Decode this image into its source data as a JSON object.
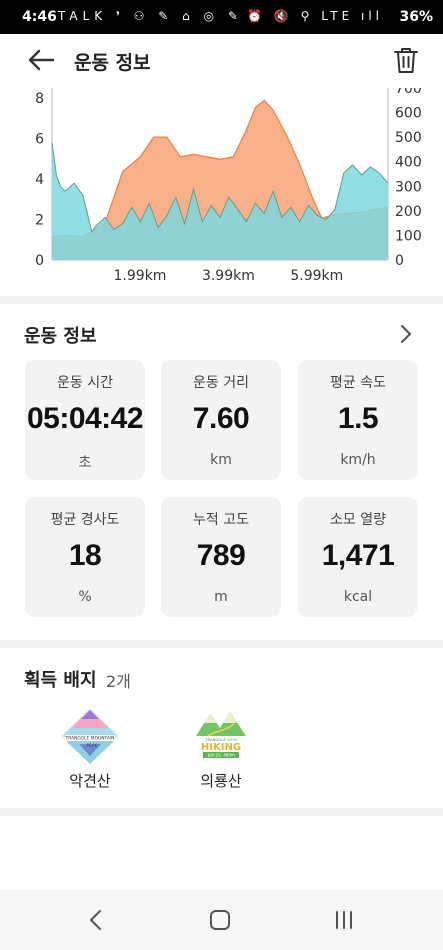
{
  "status_bar": {
    "time": "4:46",
    "left_icons": "TALK ❜ ⚇ ✎ ⌂ ◎ ✎ •",
    "right_icons": "⏰ 🔇 ⚲ LTE ıll",
    "battery": "36%"
  },
  "header": {
    "title": "운동 정보"
  },
  "chart_data": {
    "type": "area",
    "x_tick_labels": [
      "1.99km",
      "3.99km",
      "5.99km"
    ],
    "y_left_ticks": [
      "0",
      "2",
      "4",
      "6",
      "8"
    ],
    "y_right_ticks": [
      "0",
      "100",
      "200",
      "300",
      "400",
      "500",
      "600",
      "700"
    ],
    "ylim_left": [
      0,
      8.5
    ],
    "ylim_right": [
      0,
      700
    ],
    "xlim_km": [
      0,
      7.6
    ],
    "series": [
      {
        "color": "#f7b08a",
        "axis": "right",
        "x": [
          0,
          0.3,
          0.7,
          1.2,
          1.6,
          2.0,
          2.3,
          2.6,
          2.9,
          3.2,
          3.5,
          3.8,
          4.1,
          4.4,
          4.6,
          4.8,
          5.0,
          5.3,
          5.6,
          5.9,
          6.1,
          6.4,
          6.7,
          7.0,
          7.3,
          7.6
        ],
        "values": [
          95,
          100,
          95,
          150,
          360,
          420,
          500,
          500,
          420,
          430,
          420,
          410,
          420,
          530,
          620,
          650,
          610,
          510,
          390,
          250,
          170,
          185,
          190,
          195,
          205,
          215
        ]
      },
      {
        "color": "#7ed8e0",
        "axis": "left",
        "x": [
          0,
          0.1,
          0.2,
          0.3,
          0.5,
          0.7,
          0.8,
          0.9,
          1.0,
          1.2,
          1.4,
          1.6,
          1.8,
          2.0,
          2.2,
          2.4,
          2.6,
          2.8,
          3.0,
          3.2,
          3.4,
          3.6,
          3.8,
          4.0,
          4.2,
          4.4,
          4.6,
          4.8,
          5.0,
          5.2,
          5.4,
          5.6,
          5.8,
          6.0,
          6.2,
          6.4,
          6.6,
          6.8,
          7.0,
          7.2,
          7.4,
          7.6
        ],
        "values": [
          5.8,
          4.2,
          3.6,
          3.4,
          3.8,
          3.2,
          2.3,
          1.4,
          1.7,
          2.1,
          1.5,
          1.8,
          2.6,
          1.9,
          2.8,
          1.6,
          2.2,
          3.1,
          1.8,
          3.5,
          1.9,
          2.7,
          2.1,
          3.1,
          2.5,
          1.9,
          2.8,
          2.3,
          3.4,
          2.1,
          2.6,
          1.9,
          2.7,
          2.2,
          2.0,
          2.5,
          4.3,
          4.7,
          4.2,
          4.6,
          4.3,
          3.8
        ]
      }
    ]
  },
  "info": {
    "title": "운동 정보",
    "stats": [
      {
        "label": "운동 시간",
        "value": "05:04:42",
        "unit": "초"
      },
      {
        "label": "운동 거리",
        "value": "7.60",
        "unit": "km"
      },
      {
        "label": "평균 속도",
        "value": "1.5",
        "unit": "km/h"
      },
      {
        "label": "평균 경사도",
        "value": "18",
        "unit": "%"
      },
      {
        "label": "누적 고도",
        "value": "789",
        "unit": "m"
      },
      {
        "label": "소모 열량",
        "value": "1,471",
        "unit": "kcal"
      }
    ]
  },
  "badges": {
    "title": "획득 배지",
    "count": "2개",
    "items": [
      {
        "name": "악견산",
        "logo_text_top": "TRANGGLE MOUNTAIN",
        "logo_text_bottom": "PEAK"
      },
      {
        "name": "의룡산",
        "logo_text_top": "TRANGGLE 2019",
        "logo_text_main": "HIKING",
        "logo_text_bottom": "등반고도 480m"
      }
    ]
  },
  "colors": {
    "elevation_fill": "#f7b08a",
    "elevation_line": "#e8864f",
    "speed_fill": "#7ed8e0",
    "gray_line": "#6a9a82"
  }
}
